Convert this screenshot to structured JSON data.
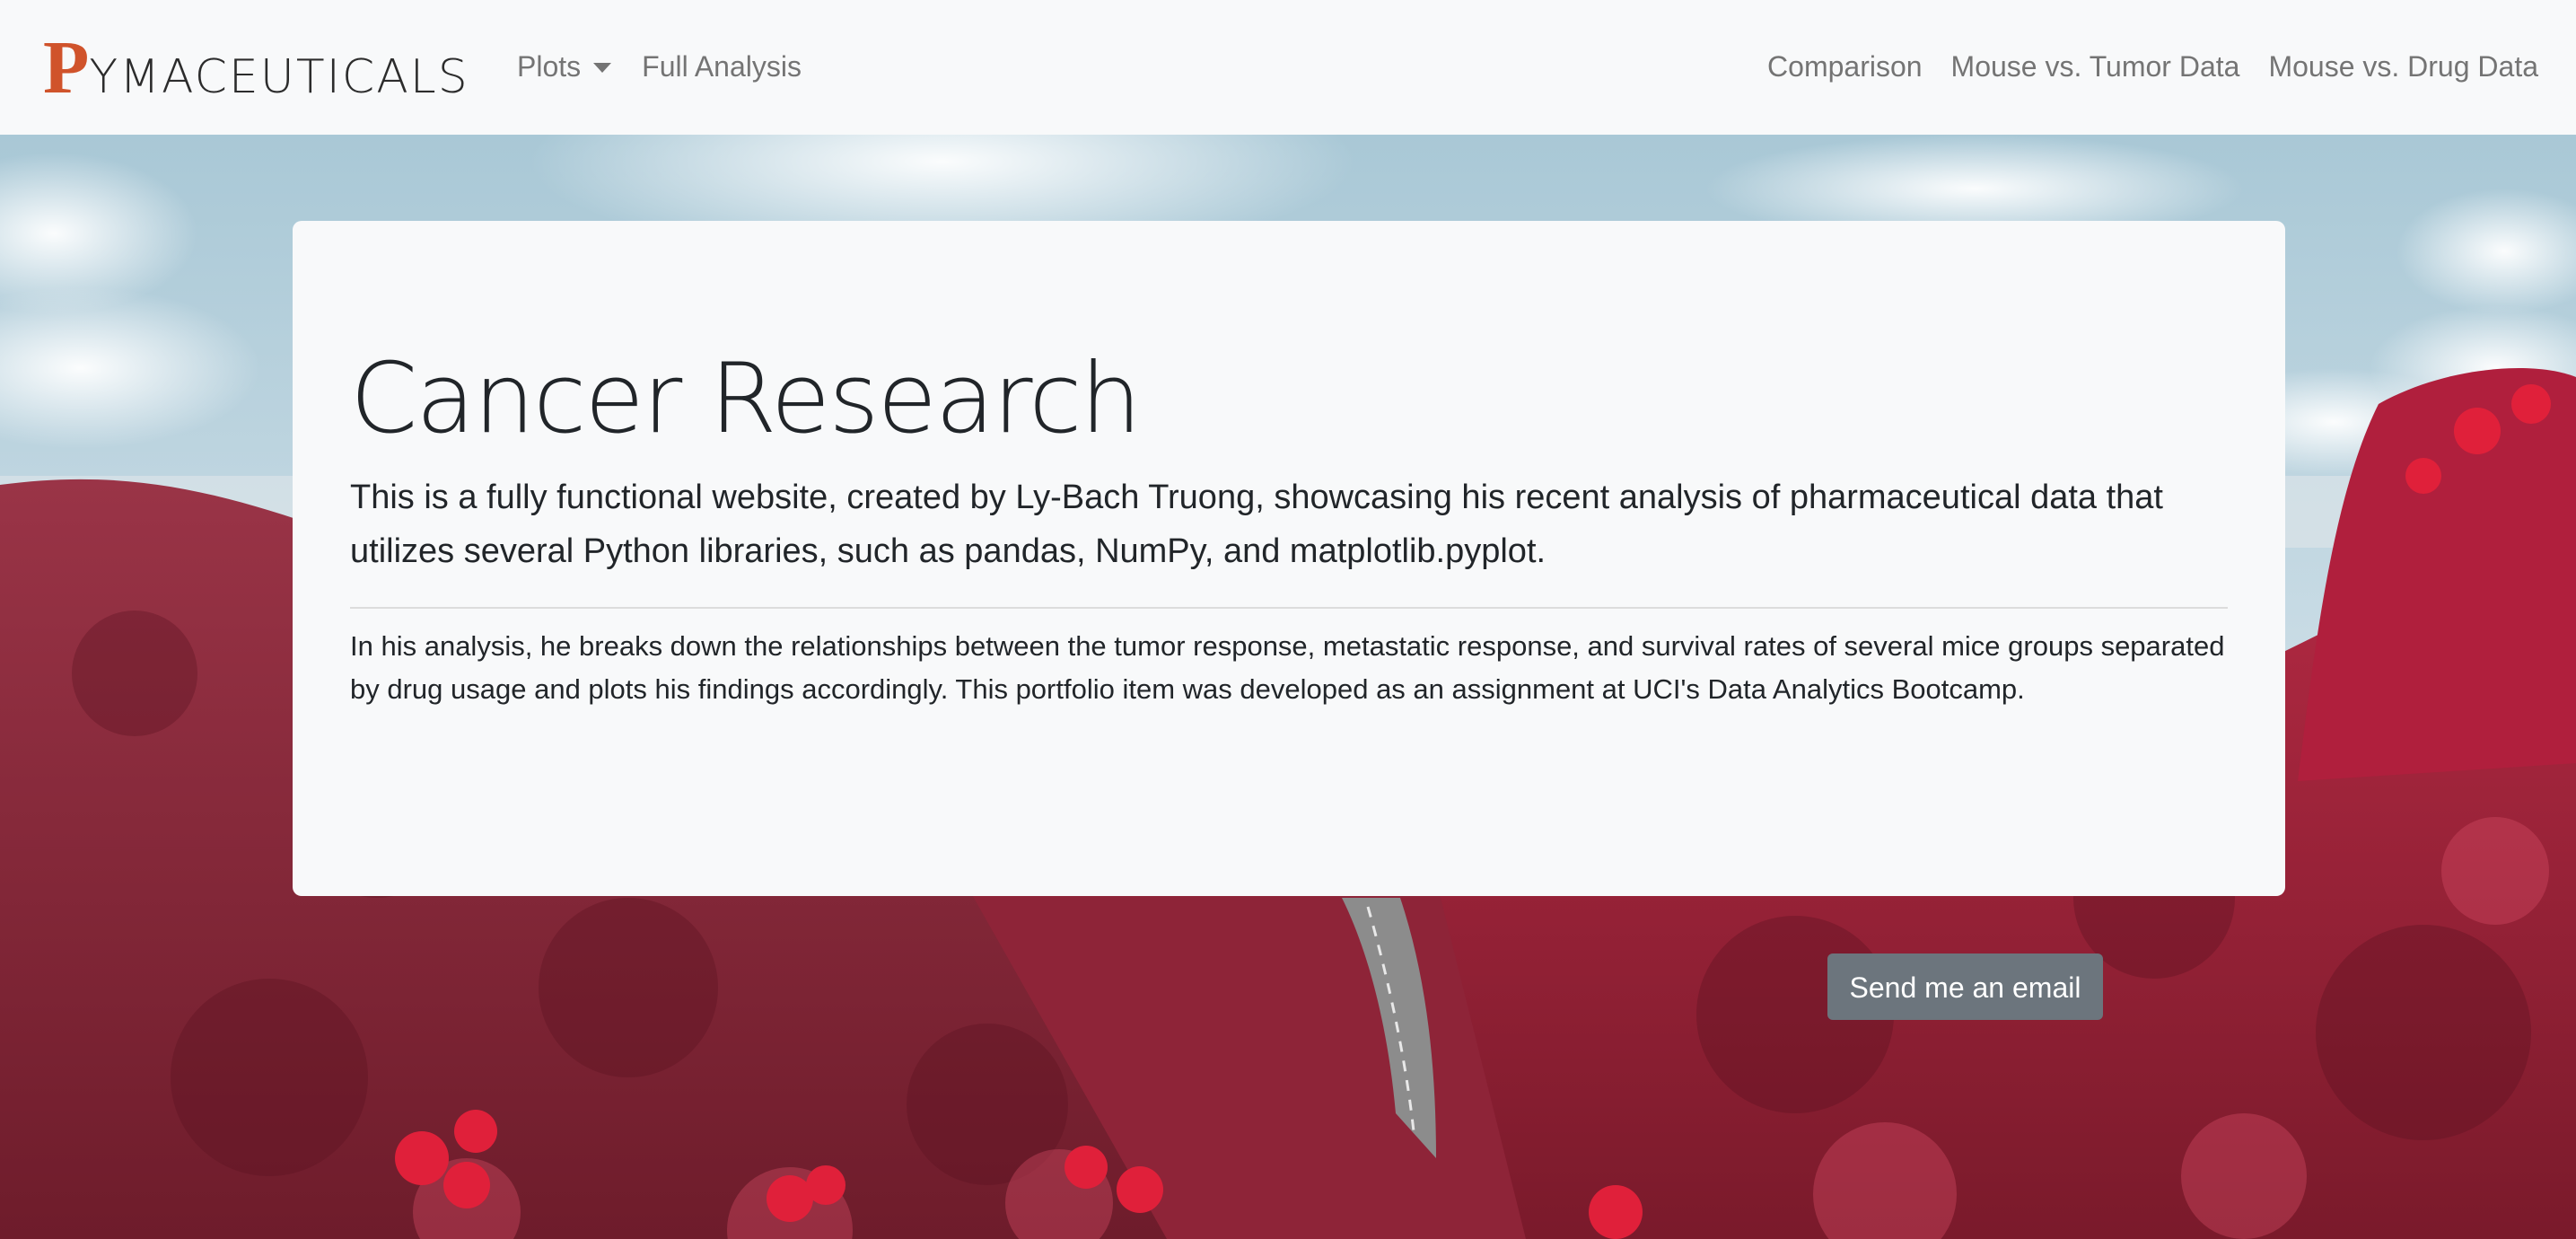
{
  "navbar": {
    "brand_initial": "P",
    "brand_rest": "YMACEUTICALS",
    "left_items": [
      {
        "label": "Plots",
        "has_dropdown": true
      },
      {
        "label": "Full Analysis"
      }
    ],
    "right_items": [
      {
        "label": "Comparison"
      },
      {
        "label": "Mouse vs. Tumor Data"
      },
      {
        "label": "Mouse vs. Drug Data"
      }
    ]
  },
  "jumbotron": {
    "title": "Cancer Research",
    "lead": "This is a fully functional website, created by Ly-Bach Truong, showcasing his recent analysis of pharmaceutical data that utilizes several Python libraries, such as pandas, NumPy, and matplotlib.pyplot.",
    "body": "In his analysis, he breaks down the relationships between the tumor response, metastatic response, and survival rates of several mice groups separated by drug usage and plots his findings accordingly. This portfolio item was developed as an assignment at UCI's Data Analytics Bootcamp."
  },
  "email_button": {
    "label": "Send me an email"
  },
  "colors": {
    "brand_accent": "#d0532b",
    "navbar_bg": "#f8f9fa",
    "card_bg": "#f8f9fa",
    "nav_text": "#747474",
    "button_bg": "#6c757d",
    "foliage": "#a8263f"
  },
  "icons": {
    "dropdown": "caret-down-icon"
  }
}
